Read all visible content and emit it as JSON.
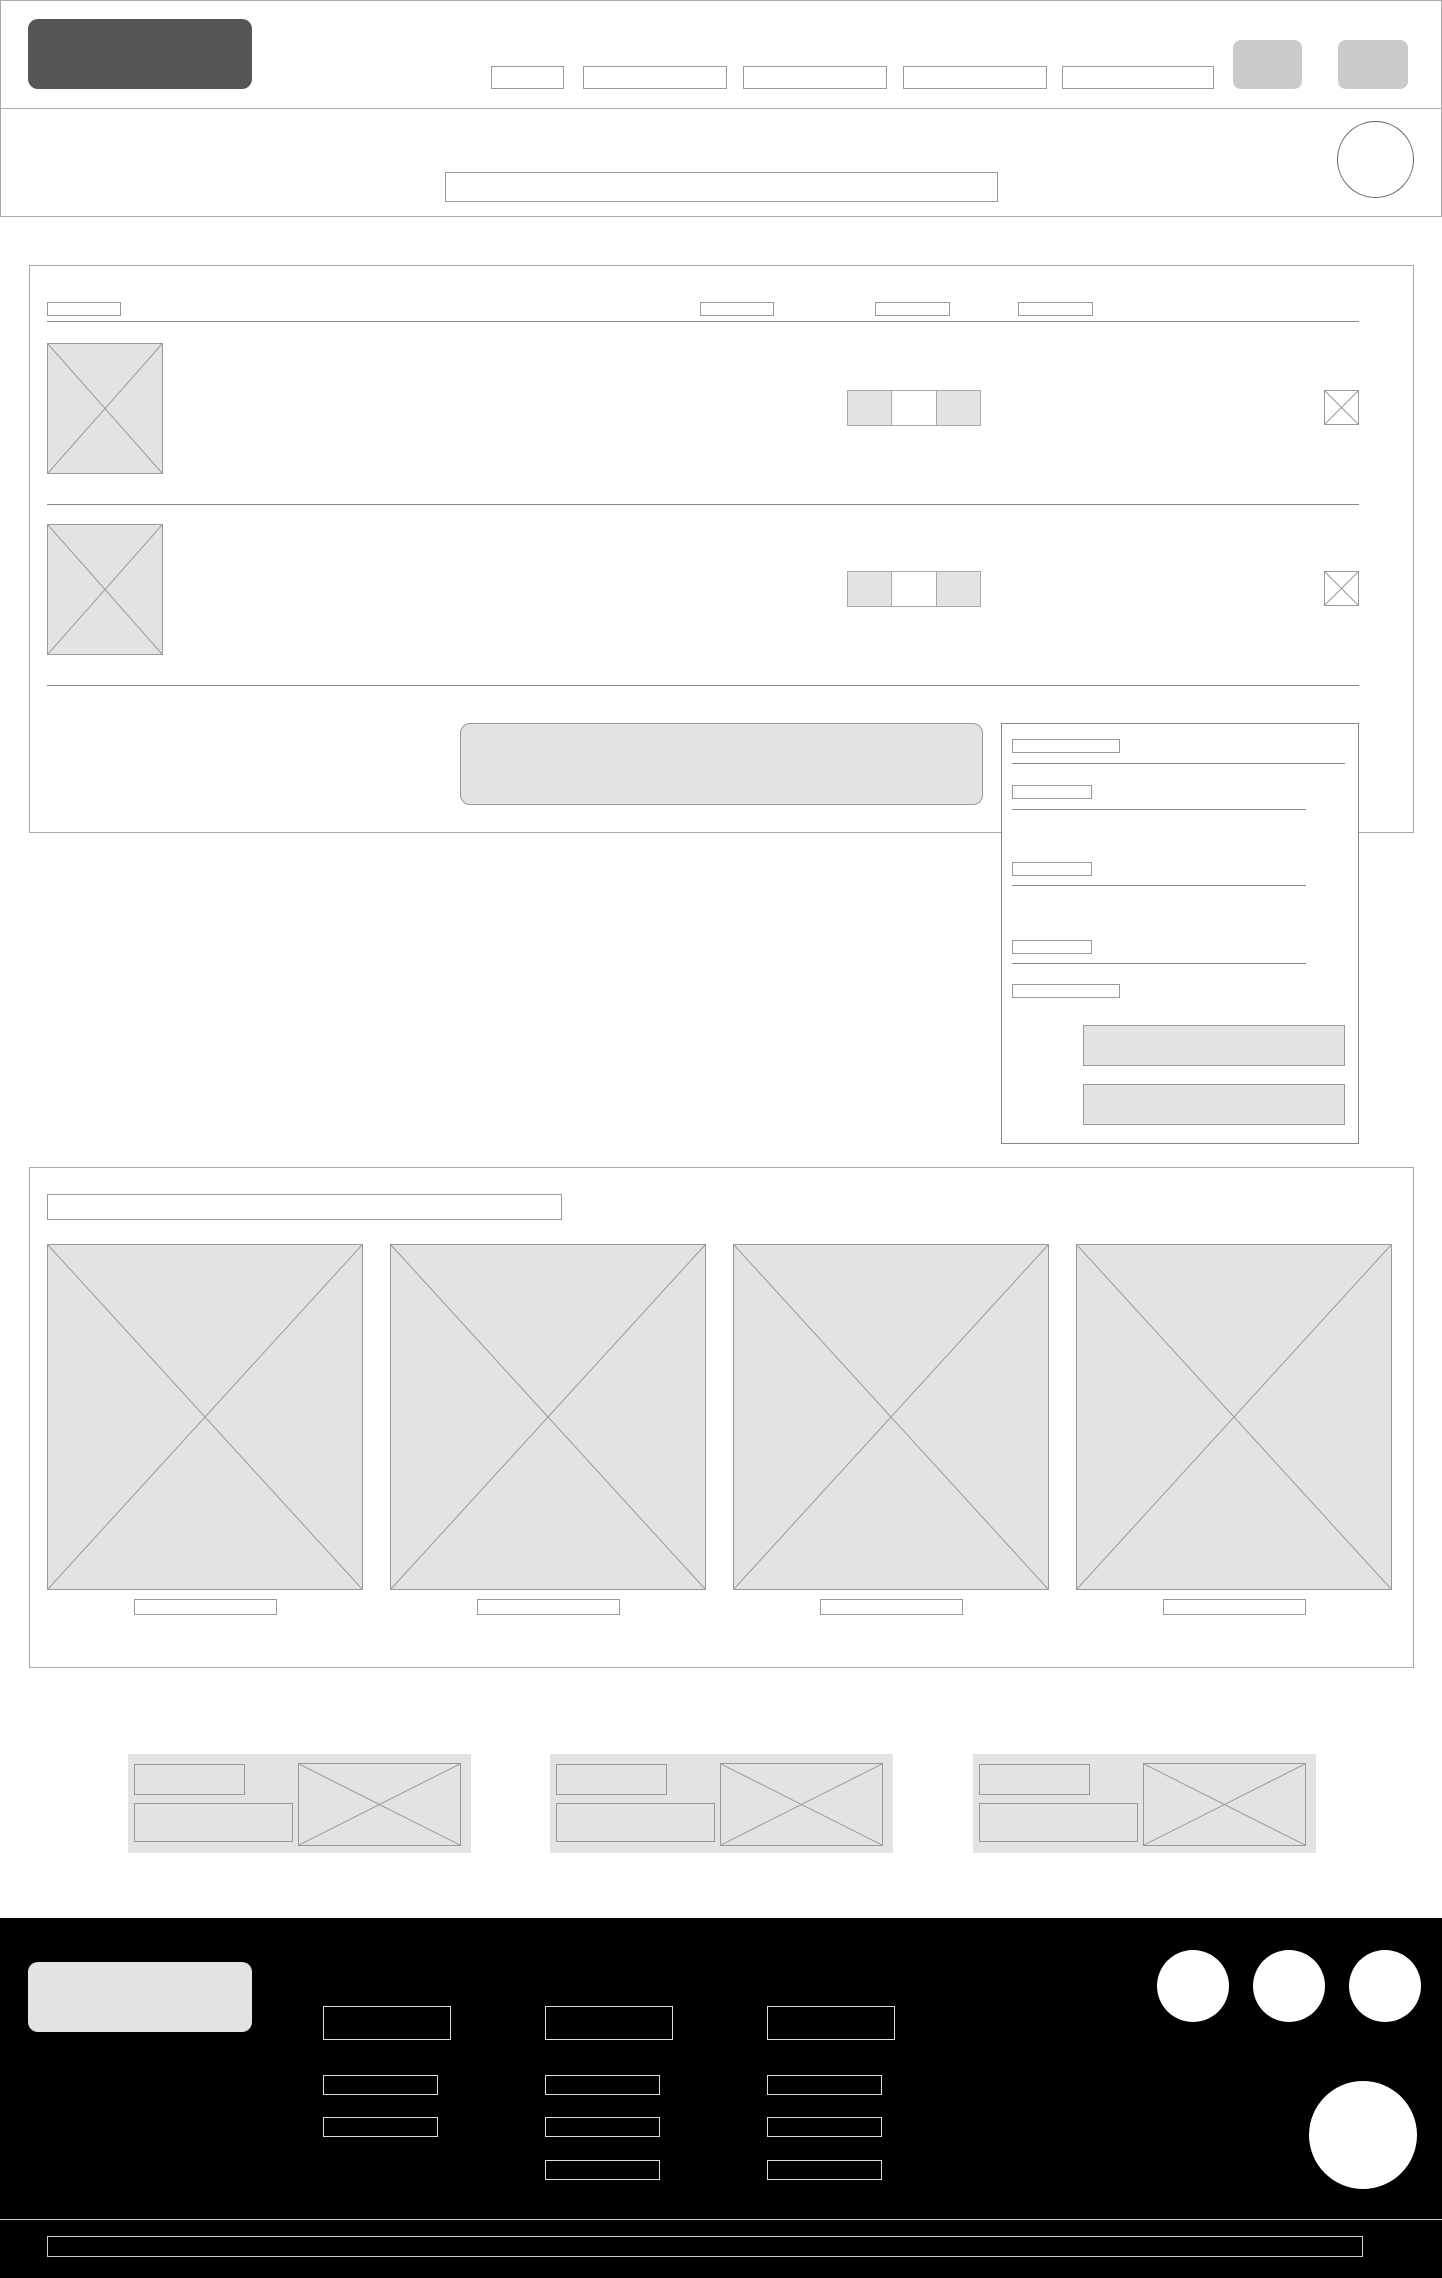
{
  "wireframe": {
    "style": "low-fidelity placeholder wireframe; no readable text",
    "colors": {
      "fill_placeholder": "#e3e3e3",
      "outline": "#999999",
      "logo_fill": "#555555",
      "header_button": "#cbcbcb",
      "footer_background": "#000000"
    }
  },
  "header": {
    "logo": "",
    "nav": [
      "",
      "",
      "",
      "",
      ""
    ],
    "actions": [
      "",
      ""
    ],
    "search_placeholder": "",
    "avatar_icon": "user-avatar"
  },
  "cart": {
    "columns": [
      "",
      "",
      "",
      ""
    ],
    "items": [
      {
        "image": "product-image",
        "quantity": "",
        "remove_icon": "close-icon"
      },
      {
        "image": "product-image",
        "quantity": "",
        "remove_icon": "close-icon"
      }
    ],
    "coupon": ""
  },
  "summary": {
    "title": "",
    "rows": [
      "",
      "",
      ""
    ],
    "total": "",
    "buttons": [
      "",
      ""
    ]
  },
  "recommendations": {
    "title": "",
    "products": [
      {
        "image": "product-image",
        "caption": ""
      },
      {
        "image": "product-image",
        "caption": ""
      },
      {
        "image": "product-image",
        "caption": ""
      },
      {
        "image": "product-image",
        "caption": ""
      }
    ]
  },
  "promos": [
    {
      "title": "",
      "text": "",
      "image": "promo-image"
    },
    {
      "title": "",
      "text": "",
      "image": "promo-image"
    },
    {
      "title": "",
      "text": "",
      "image": "promo-image"
    }
  ],
  "footer": {
    "logo": "",
    "columns": [
      {
        "heading": "",
        "links": [
          "",
          ""
        ]
      },
      {
        "heading": "",
        "links": [
          "",
          "",
          ""
        ]
      },
      {
        "heading": "",
        "links": [
          "",
          "",
          ""
        ]
      }
    ],
    "social_icons": [
      "social-icon",
      "social-icon",
      "social-icon"
    ],
    "badge_icon": "badge-icon",
    "copyright": ""
  }
}
